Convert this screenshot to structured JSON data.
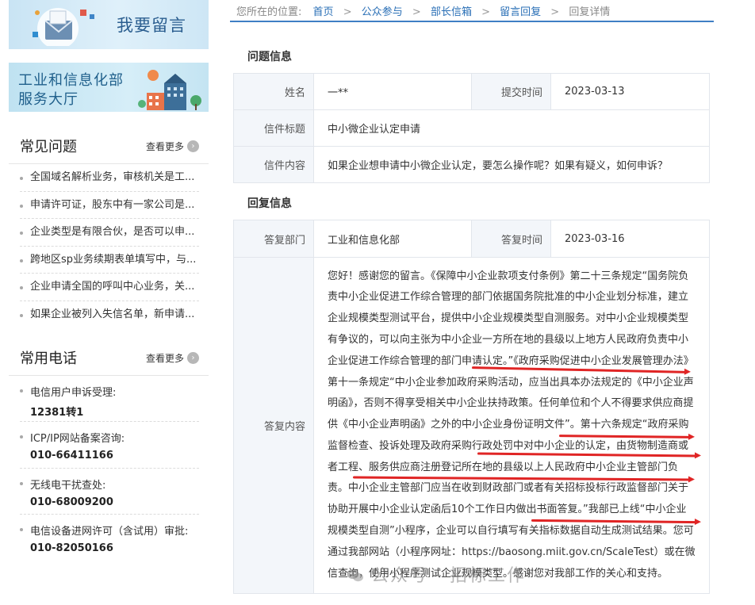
{
  "sidebar": {
    "message_banner": {
      "title": "我要留言"
    },
    "service_banner": {
      "line1": "工业和信息化部",
      "line2": "服务大厅"
    },
    "faq": {
      "title": "常见问题",
      "more": "查看更多",
      "items": [
        "全国域名解析业务，审核机关是工...",
        "申请许可证，股东中有一家公司是...",
        "企业类型是有限合伙，是否可以申...",
        "跨地区sp业务续期表单填写中，与...",
        "企业申请全国的呼叫中心业务，关...",
        "如果企业被列入失信名单，新申请..."
      ]
    },
    "phones": {
      "title": "常用电话",
      "more": "查看更多",
      "items": [
        {
          "label": "电信用户申诉受理:",
          "number": "12381转1"
        },
        {
          "label": "ICP/IP网站备案咨询:",
          "number": "010-66411166"
        },
        {
          "label": "无线电干扰查处:",
          "number": "010-68009200"
        },
        {
          "label": "电信设备进网许可（含试用）审批:",
          "number": "010-82050166"
        }
      ]
    }
  },
  "breadcrumb": {
    "prefix": "您所在的位置:",
    "items": [
      "首页",
      "公众参与",
      "部长信箱",
      "留言回复"
    ],
    "current": "回复详情",
    "separator": ">"
  },
  "question": {
    "section_title": "问题信息",
    "name_label": "姓名",
    "name_value": "一**",
    "submit_time_label": "提交时间",
    "submit_time_value": "2023-03-13",
    "subject_label": "信件标题",
    "subject_value": "中小微企业认定申请",
    "content_label": "信件内容",
    "content_value": "如果企业想申请中小微企业认定，要怎么操作呢？如果有疑义，如何申诉？"
  },
  "reply": {
    "section_title": "回复信息",
    "dept_label": "答复部门",
    "dept_value": "工业和信息化部",
    "time_label": "答复时间",
    "time_value": "2023-03-16",
    "content_label": "答复内容",
    "content_value": "您好！感谢您的留言。《保障中小企业款项支付条例》第二十三条规定“国务院负责中小企业促进工作综合管理的部门依据国务院批准的中小企业划分标准，建立企业规模类型测试平台，提供中小企业规模类型自测服务。对中小企业规模类型有争议的，可以向主张为中小企业一方所在地的县级以上地方人民政府负责中小企业促进工作综合管理的部门申请认定。”《政府采购促进中小企业发展管理办法》第十一条规定“中小企业参加政府采购活动，应当出具本办法规定的《中小企业声明函》，否则不得享受相关中小企业扶持政策。任何单位和个人不得要求供应商提供《中小企业声明函》之外的中小企业身份证明文件”。第十六条规定“政府采购监督检查、投诉处理及政府采购行政处罚中对中小企业的认定，由货物制造商或者工程、服务供应商注册登记所在地的县级以上人民政府中小企业主管部门负责。中小企业主管部门应当在收到财政部门或者有关招标投标行政监督部门关于协助开展中小企业认定函后10个工作日内做出书面答复。”我部已上线“中小企业规模类型自测”小程序，企业可以自行填写有关指标数据自动生成测试结果。您可通过我部网站（小程序网址：https://baosong.miit.gov.cn/ScaleTest）或在微信查询，使用小程序测试企业规模类型。感谢您对我部工作的关心和支持。"
  },
  "watermark": {
    "text": "公众号 · 招标工作",
    "icon": "wechat-icon"
  },
  "colors": {
    "link": "#2a6fb6",
    "crumb_line": "#3f7fc4",
    "label_bg": "#f3f6fa",
    "annotation_red": "#e02525"
  }
}
